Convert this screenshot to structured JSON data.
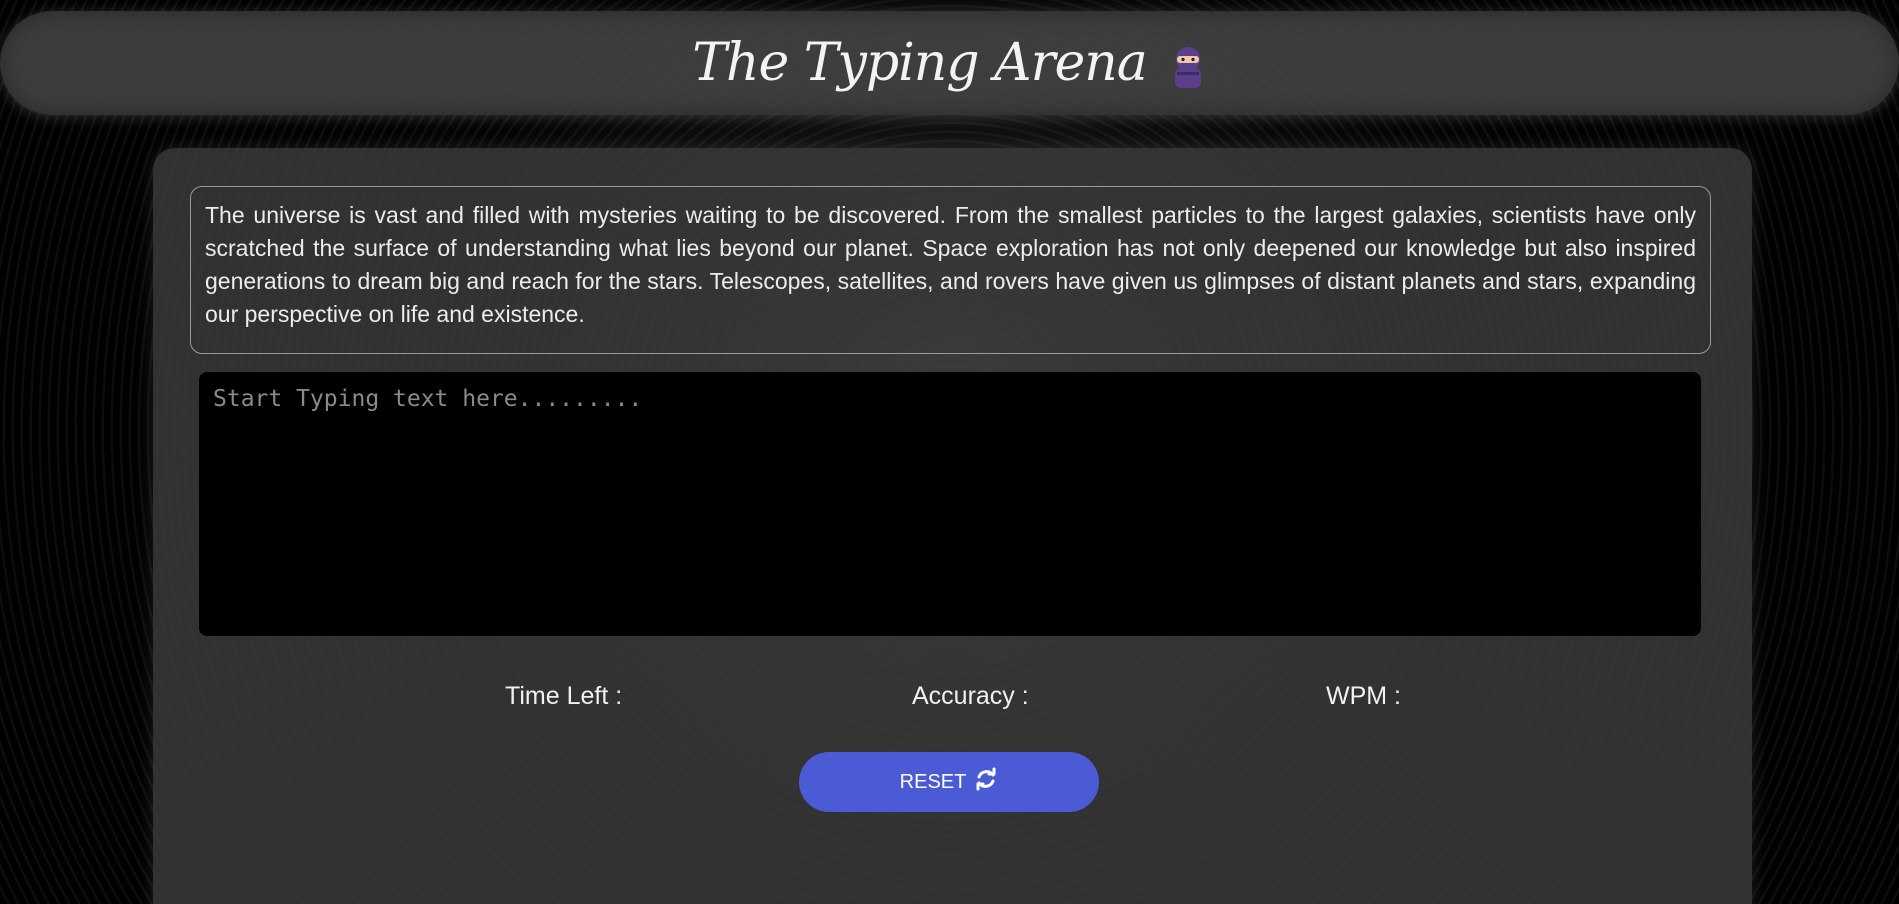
{
  "header": {
    "title": "The Typing Arena",
    "icon": "ninja-icon"
  },
  "passage": {
    "text": "The universe is vast and filled with mysteries waiting to be discovered. From the smallest particles to the largest galaxies, scientists have only scratched the surface of understanding what lies beyond our planet. Space exploration has not only deepened our knowledge but also inspired generations to dream big and reach for the stars. Telescopes, satellites, and rovers have given us glimpses of distant planets and stars, expanding our perspective on life and existence."
  },
  "input": {
    "placeholder": "Start Typing text here.........",
    "value": ""
  },
  "stats": {
    "time_left_label": "Time Left :",
    "accuracy_label": "Accuracy :",
    "wpm_label": "WPM :"
  },
  "actions": {
    "reset_label": "RESET",
    "reset_icon": "refresh-icon"
  },
  "colors": {
    "reset_button": "#4b5bd6",
    "background": "#000000",
    "panel": "#3c3c3c"
  }
}
